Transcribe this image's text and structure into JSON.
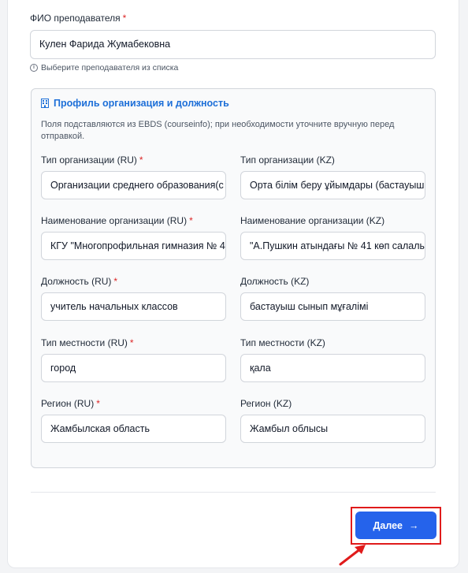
{
  "teacher": {
    "label": "ФИО преподавателя",
    "required_mark": "*",
    "value": "Кулен Фарида Жумабековна",
    "hint": "Выберите преподавателя из списка"
  },
  "profile": {
    "title": "Профиль организация и должность",
    "description": "Поля подставляются из EBDS (courseinfo); при необходимости уточните вручную перед отправкой.",
    "fields": [
      {
        "label": "Тип организации (RU)",
        "required": "*",
        "value": "Организации среднего образования(с"
      },
      {
        "label": "Тип организации (KZ)",
        "required": "",
        "value": "Орта білім беру ұйымдары (бастауыш"
      },
      {
        "label": "Наименование организации (RU)",
        "required": "*",
        "value": "КГУ \"Многопрофильная гимназия № 4"
      },
      {
        "label": "Наименование организации (KZ)",
        "required": "",
        "value": "\"А.Пушкин атындағы № 41 көп салалы"
      },
      {
        "label": "Должность (RU)",
        "required": "*",
        "value": "учитель начальных классов"
      },
      {
        "label": "Должность (KZ)",
        "required": "",
        "value": "бастауыш сынып мұғалімі"
      },
      {
        "label": "Тип местности (RU)",
        "required": "*",
        "value": "город"
      },
      {
        "label": "Тип местности (KZ)",
        "required": "",
        "value": "қала"
      },
      {
        "label": "Регион (RU)",
        "required": "*",
        "value": "Жамбылская область"
      },
      {
        "label": "Регион (KZ)",
        "required": "",
        "value": "Жамбыл облысы"
      }
    ]
  },
  "actions": {
    "next_label": "Далее",
    "next_arrow": "→"
  },
  "colors": {
    "accent": "#2563eb",
    "required": "#dc2626",
    "annotation": "#e01b1b"
  }
}
